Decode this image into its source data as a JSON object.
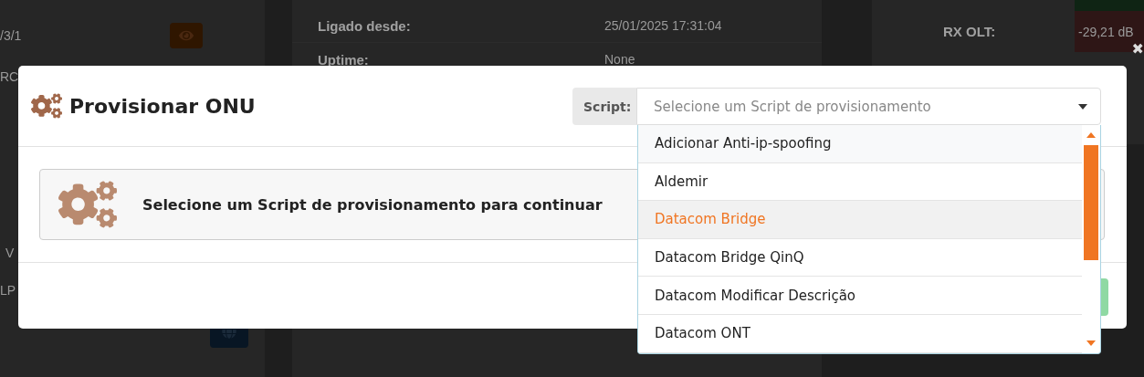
{
  "background": {
    "left_panel": {
      "rows": [
        {
          "text": "/3/1"
        },
        {
          "text": "RC"
        },
        {
          "text": "V"
        },
        {
          "text": "LP"
        }
      ]
    },
    "close": "✖",
    "details": [
      {
        "label": "Ligado desde:",
        "value": "25/01/2025 17:31:04"
      },
      {
        "label": "Uptime:",
        "value": "None"
      }
    ],
    "signal": {
      "label": "RX OLT:",
      "value": "-29,21 dB"
    }
  },
  "modal": {
    "title": "Provisionar ONU",
    "script_label": "Script:",
    "select": {
      "placeholder": "Selecione um Script de provisionamento"
    },
    "notice": "Selecione um Script de provisionamento para continuar",
    "options": [
      {
        "label": "Adicionar Anti-ip-spoofing",
        "selected": false
      },
      {
        "label": "Aldemir",
        "selected": false
      },
      {
        "label": "Datacom Bridge",
        "selected": true
      },
      {
        "label": "Datacom Bridge QinQ",
        "selected": false
      },
      {
        "label": "Datacom Modificar Descrição",
        "selected": false
      },
      {
        "label": "Datacom ONT",
        "selected": false
      }
    ]
  }
}
